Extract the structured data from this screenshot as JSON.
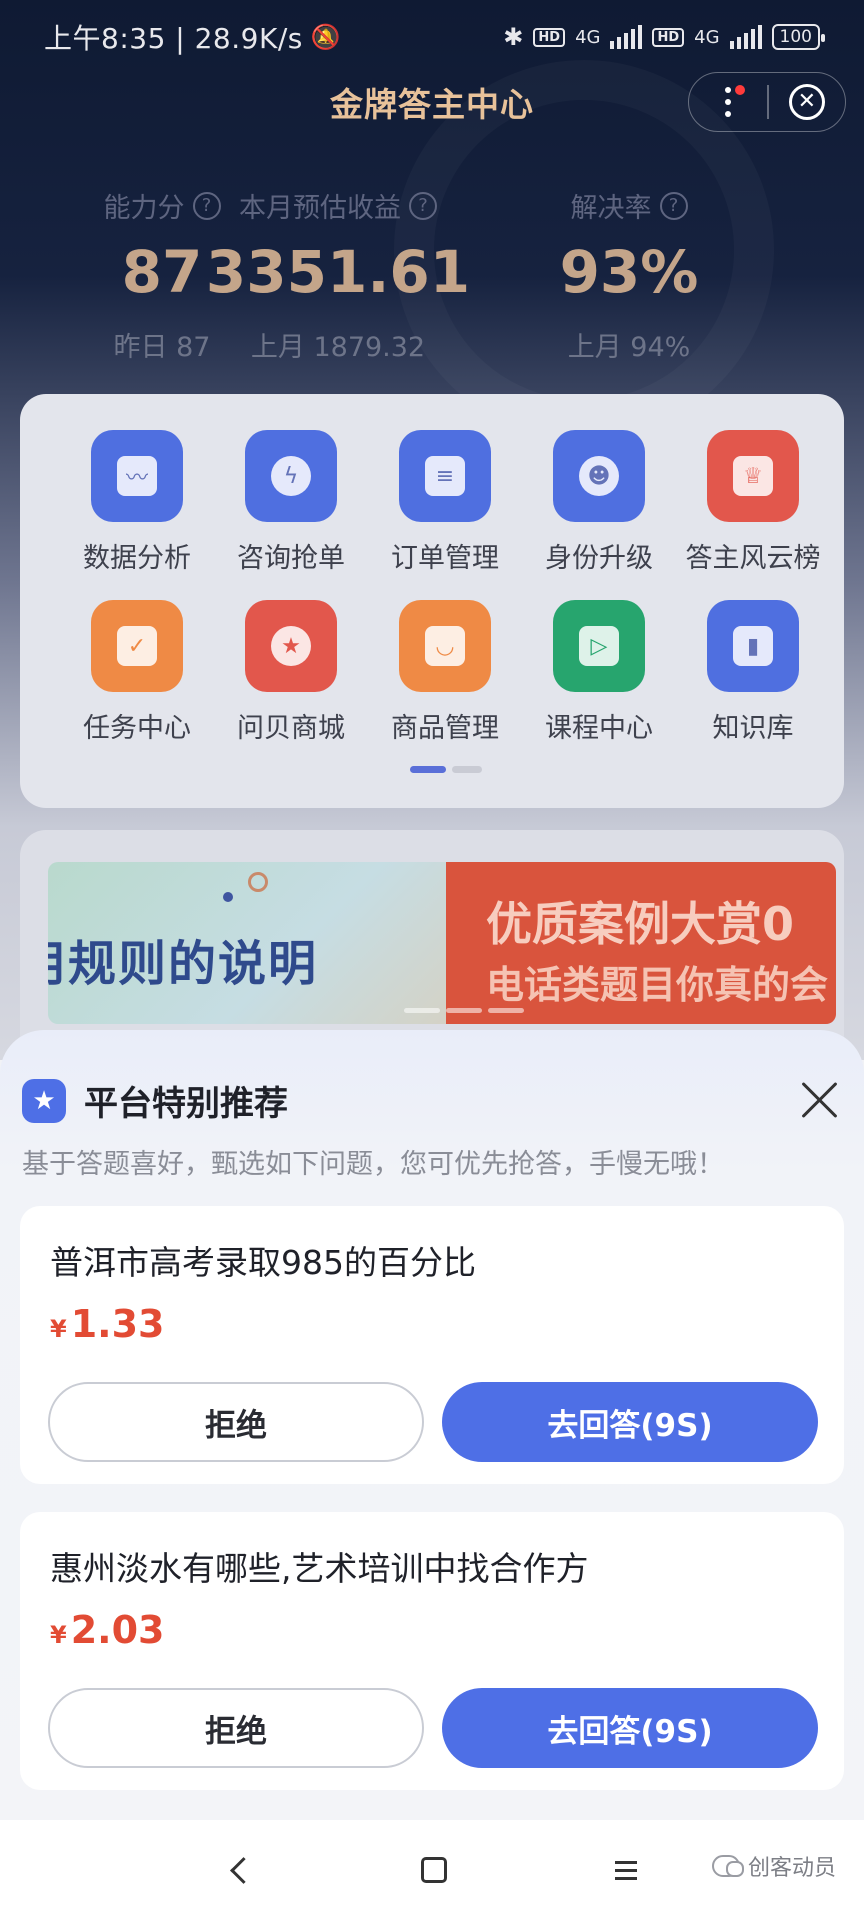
{
  "status_bar": {
    "time_speed": "上午8:35 | 28.9K/s",
    "hd1": "HD",
    "net1": "4G",
    "hd2": "HD",
    "net2": "4G",
    "battery": "100"
  },
  "header": {
    "title": "金牌答主中心",
    "close_glyph": "✕"
  },
  "stats": [
    {
      "label": "能力分",
      "value": "87",
      "sub": "昨日 87"
    },
    {
      "label": "本月预估收益",
      "value": "3351.61",
      "sub": "上月 1879.32"
    },
    {
      "label": "解决率",
      "value": "93%",
      "sub": "上月 94%"
    }
  ],
  "grid": {
    "row1": [
      {
        "label": "数据分析",
        "icon": "chart-icon",
        "color": "#4f6fe0"
      },
      {
        "label": "咨询抢单",
        "icon": "lightning-icon",
        "color": "#4f6fe0"
      },
      {
        "label": "订单管理",
        "icon": "document-icon",
        "color": "#4f6fe0"
      },
      {
        "label": "身份升级",
        "icon": "user-icon",
        "color": "#4f6fe0"
      },
      {
        "label": "答主风云榜",
        "icon": "trophy-icon",
        "color": "#e2574c"
      }
    ],
    "row2": [
      {
        "label": "任务中心",
        "icon": "task-icon",
        "color": "#ef8a45"
      },
      {
        "label": "问贝商城",
        "icon": "shop-icon",
        "color": "#e2574c"
      },
      {
        "label": "商品管理",
        "icon": "bag-icon",
        "color": "#ef8a45"
      },
      {
        "label": "课程中心",
        "icon": "video-icon",
        "color": "#27a56e"
      },
      {
        "label": "知识库",
        "icon": "book-icon",
        "color": "#4f6fe0"
      }
    ]
  },
  "banner": {
    "left_text": "用规则的说明",
    "right_title": "优质案例大赏0",
    "right_sub": "电话类题目你真的会"
  },
  "sheet": {
    "title": "平台特别推荐",
    "subtitle": "基于答题喜好，甄选如下问题，您可优先抢答，手慢无哦！",
    "questions": [
      {
        "text": "普洱市高考录取985的百分比",
        "currency": "¥",
        "price": "1.33",
        "reject": "拒绝",
        "answer": "去回答(9S)"
      },
      {
        "text": "惠州淡水有哪些,艺术培训中找合作方",
        "currency": "¥",
        "price": "2.03",
        "reject": "拒绝",
        "answer": "去回答(9S)"
      }
    ]
  },
  "watermark": "创客动员",
  "colors": {
    "accent_blue": "#4e6fe6",
    "price_red": "#e24b34",
    "gold": "#c4a58a"
  }
}
